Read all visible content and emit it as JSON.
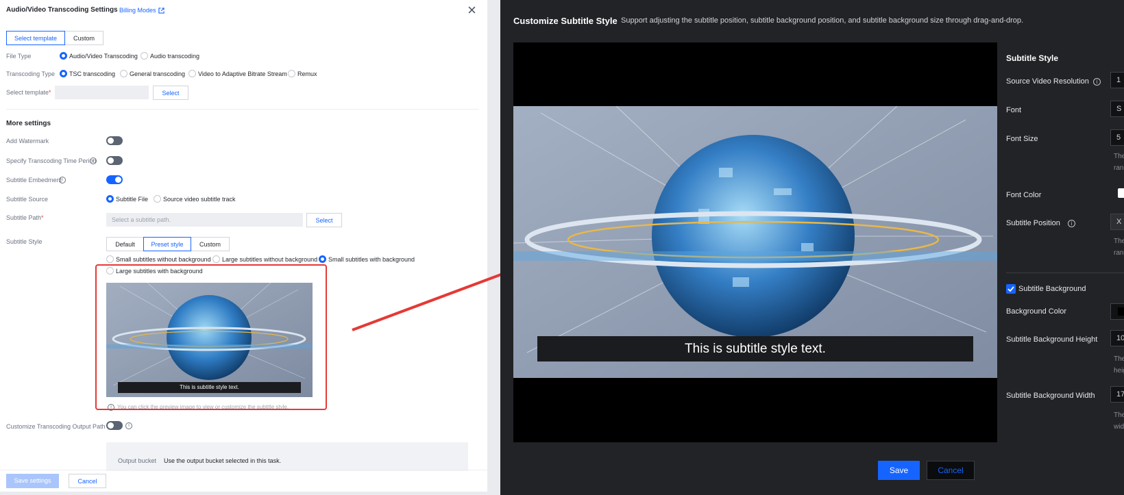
{
  "left_dialog": {
    "title": "Audio/Video Transcoding Settings",
    "billing_link": "Billing Modes",
    "tabs": [
      "Select template",
      "Custom"
    ],
    "file_type": {
      "label": "File Type",
      "options": [
        "Audio/Video Transcoding",
        "Audio transcoding"
      ],
      "selected": "Audio/Video Transcoding"
    },
    "transcoding_type": {
      "label": "Transcoding Type",
      "options": [
        "TSC transcoding",
        "General transcoding",
        "Video to Adaptive Bitrate Stream",
        "Remux"
      ],
      "selected": "TSC transcoding"
    },
    "select_template": {
      "label": "Select template",
      "required_mark": "*",
      "value": "",
      "button": "Select"
    },
    "more_settings": "More settings",
    "add_watermark": {
      "label": "Add Watermark",
      "on": false
    },
    "time_period": {
      "label": "Specify Transcoding Time Period",
      "on": false
    },
    "subtitle_embedment": {
      "label": "Subtitle Embedment",
      "on": true
    },
    "subtitle_source": {
      "label": "Subtitle Source",
      "options": [
        "Subtitle File",
        "Source video subtitle track"
      ],
      "selected": "Subtitle File"
    },
    "subtitle_path": {
      "label": "Subtitle Path",
      "required_mark": "*",
      "placeholder": "Select a subtitle path.",
      "button": "Select"
    },
    "subtitle_style": {
      "label": "Subtitle Style",
      "tabs": [
        "Default",
        "Preset style",
        "Custom"
      ],
      "selected_tab": "Preset style",
      "presets": [
        "Small subtitles without background",
        "Large subtitles without background",
        "Small subtitles with background",
        "Large subtitles with background"
      ],
      "selected_preset": "Small subtitles with background",
      "preview_caption": "This is subtitle style text.",
      "preview_hint": "You can click the preview image to view or customize the subtitle style."
    },
    "output_path": {
      "label": "Customize Transcoding Output Path",
      "on": false
    },
    "output_bucket": {
      "label": "Output bucket",
      "value": "Use the output bucket selected in this task."
    },
    "footer": {
      "save": "Save settings",
      "cancel": "Cancel"
    }
  },
  "right_modal": {
    "title": "Customize Subtitle Style",
    "description": "Support adjusting the subtitle position, subtitle background position, and subtitle background size through drag-and-drop.",
    "preview_caption": "This is subtitle style text.",
    "panel": {
      "heading": "Subtitle Style",
      "source_resolution": {
        "label": "Source Video Resolution",
        "value": "1"
      },
      "font": {
        "label": "Font",
        "value": "S"
      },
      "font_size": {
        "label": "Font Size",
        "value": "5",
        "hint": [
          "The",
          "ran"
        ]
      },
      "font_color": {
        "label": "Font Color"
      },
      "subtitle_position": {
        "label": "Subtitle Position",
        "value": "X",
        "hint": [
          "The",
          "ran"
        ]
      },
      "subtitle_background": {
        "label": "Subtitle Background",
        "checked": true
      },
      "background_color": {
        "label": "Background Color"
      },
      "bg_height": {
        "label": "Subtitle Background Height",
        "value": "10",
        "hint": [
          "The",
          "heig"
        ]
      },
      "bg_width": {
        "label": "Subtitle Background Width",
        "value": "17",
        "hint": [
          "The",
          "widt"
        ]
      }
    },
    "footer": {
      "save": "Save",
      "cancel": "Cancel"
    }
  },
  "colors": {
    "primary": "#1664ff",
    "annotation_red": "#e53935",
    "dark_bg": "#222326"
  },
  "icons": [
    "external-link-icon",
    "close-icon",
    "info-icon",
    "check-icon"
  ]
}
